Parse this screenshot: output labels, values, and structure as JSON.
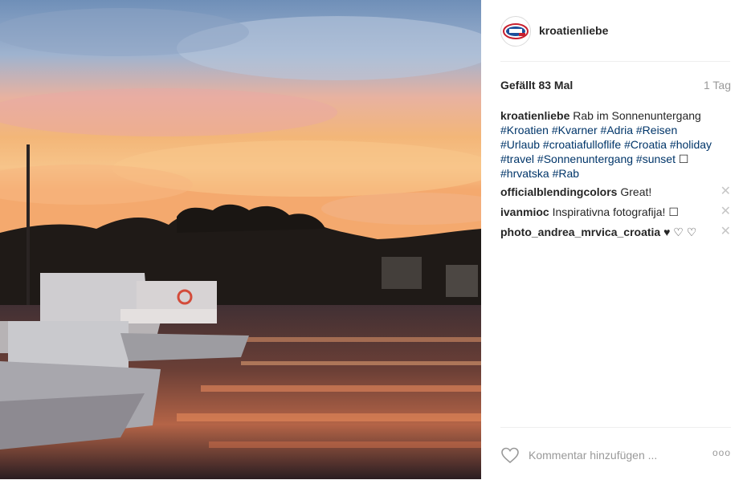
{
  "post": {
    "username": "kroatienliebe",
    "likes": "Gefällt 83 Mal",
    "age": "1 Tag"
  },
  "caption": {
    "user": "kroatienliebe",
    "text": "Rab im Sonnenuntergang",
    "tags": [
      "#Kroatien",
      "#Kvarner",
      "#Adria",
      "#Reisen",
      "#Urlaub",
      "#croatiafulloflife",
      "#Croatia",
      "#holiday",
      "#travel",
      "#Sonnenuntergang",
      "#sunset",
      "#hrvatska",
      "#Rab"
    ],
    "emoji": "☐"
  },
  "comments": [
    {
      "user": "officialblendingcolors",
      "text": "Great!"
    },
    {
      "user": "ivanmioc",
      "text": "Inspirativna fotografija! ☐"
    },
    {
      "user": "photo_andrea_mrvica_croatia",
      "text": "♥ ♡ ♡"
    }
  ],
  "footer": {
    "placeholder": "Kommentar hinzufügen ...",
    "more": "ooo"
  },
  "icons": {
    "like": "heart-icon",
    "delete": "close-icon",
    "options": "more-options-icon"
  },
  "colors": {
    "link": "#003569",
    "text": "#262626",
    "muted": "#999999"
  }
}
